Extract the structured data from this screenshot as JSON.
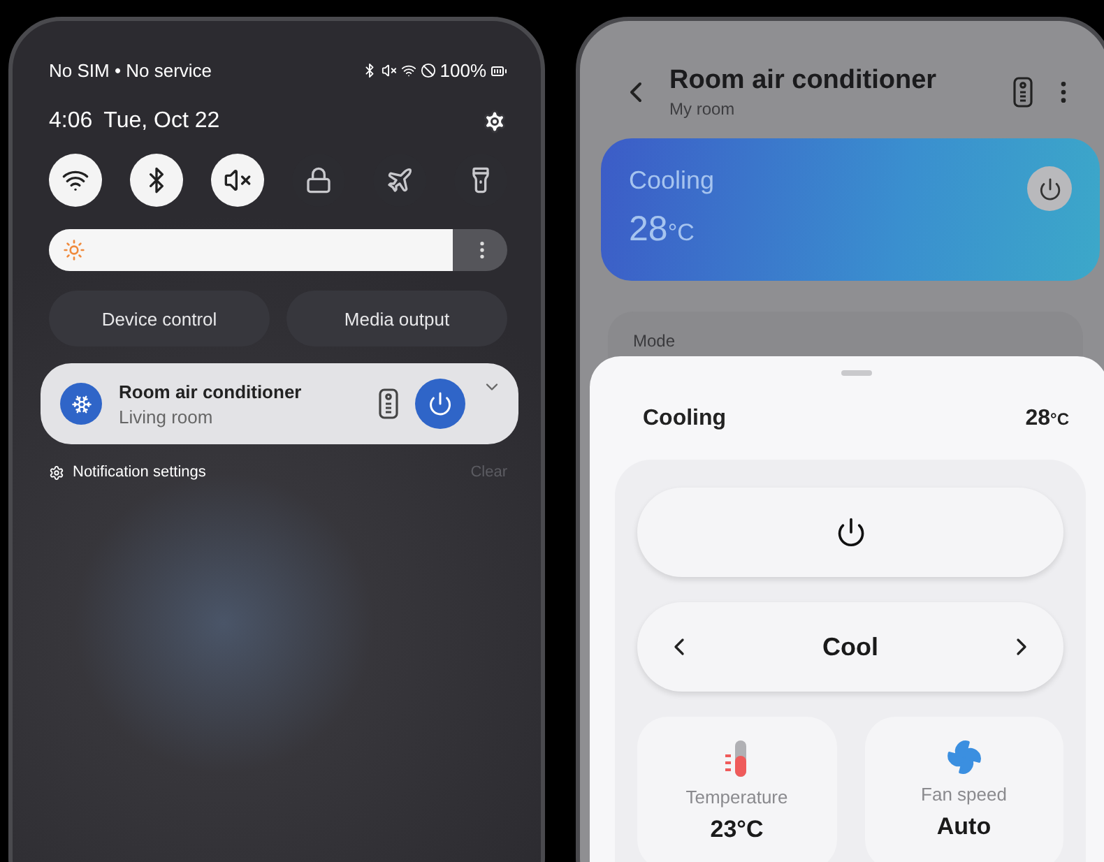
{
  "notification_shade": {
    "status_bar": {
      "carrier": "No SIM • No service",
      "battery": "100%"
    },
    "clock": {
      "time": "4:06",
      "date": "Tue, Oct 22"
    },
    "quick_toggles": [
      {
        "kind": "wifi",
        "on": true
      },
      {
        "kind": "bluetooth",
        "on": true
      },
      {
        "kind": "mute",
        "on": true
      },
      {
        "kind": "lock",
        "on": false
      },
      {
        "kind": "airplane",
        "on": false
      },
      {
        "kind": "flashlight",
        "on": false
      }
    ],
    "brightness": {
      "level": 0.88
    },
    "shortcuts": [
      "Device control",
      "Media output"
    ],
    "notification": {
      "title": "Room air conditioner",
      "subtitle": "Living room",
      "power_on": true
    },
    "footer": {
      "settings_label": "Notification settings",
      "clear_label": "Clear"
    }
  },
  "device_screen": {
    "title": "Room air conditioner",
    "subtitle": "My room",
    "status_card": {
      "state": "Cooling",
      "temperature": "28",
      "unit": "°C"
    },
    "mode_label": "Mode",
    "sheet": {
      "state": "Cooling",
      "temperature": "28",
      "unit": "°C",
      "mode": "Cool",
      "tiles": [
        {
          "kind": "temperature",
          "label": "Temperature",
          "value": "23°C"
        },
        {
          "kind": "fan",
          "label": "Fan speed",
          "value": "Auto"
        }
      ]
    }
  }
}
